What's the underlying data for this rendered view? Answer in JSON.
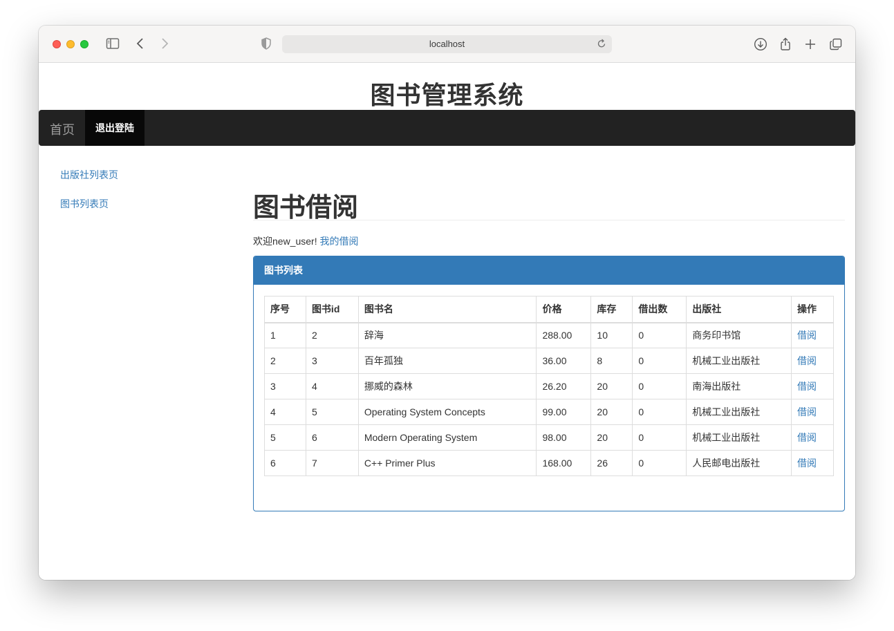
{
  "browser": {
    "url": "localhost"
  },
  "site": {
    "title": "图书管理系统"
  },
  "navbar": {
    "brand": "首页",
    "logout": "退出登陆"
  },
  "sidebar": {
    "items": [
      {
        "label": "出版社列表页"
      },
      {
        "label": "图书列表页"
      }
    ]
  },
  "main": {
    "header": "图书借阅",
    "welcome_text": "欢迎new_user!",
    "my_borrow_link": "我的借阅",
    "panel_title": "图书列表"
  },
  "table": {
    "columns": [
      "序号",
      "图书id",
      "图书名",
      "价格",
      "库存",
      "借出数",
      "出版社",
      "操作"
    ],
    "rows": [
      [
        "1",
        "2",
        "辞海",
        "288.00",
        "10",
        "0",
        "商务印书馆",
        "借阅"
      ],
      [
        "2",
        "3",
        "百年孤独",
        "36.00",
        "8",
        "0",
        "机械工业出版社",
        "借阅"
      ],
      [
        "3",
        "4",
        "挪威的森林",
        "26.20",
        "20",
        "0",
        "南海出版社",
        "借阅"
      ],
      [
        "4",
        "5",
        "Operating System Concepts",
        "99.00",
        "20",
        "0",
        "机械工业出版社",
        "借阅"
      ],
      [
        "5",
        "6",
        "Modern Operating System",
        "98.00",
        "20",
        "0",
        "机械工业出版社",
        "借阅"
      ],
      [
        "6",
        "7",
        "C++ Primer Plus",
        "168.00",
        "26",
        "0",
        "人民邮电出版社",
        "借阅"
      ]
    ]
  },
  "colors": {
    "primary": "#337ab7",
    "navbar": "#222222",
    "navbar_active": "#080808"
  }
}
